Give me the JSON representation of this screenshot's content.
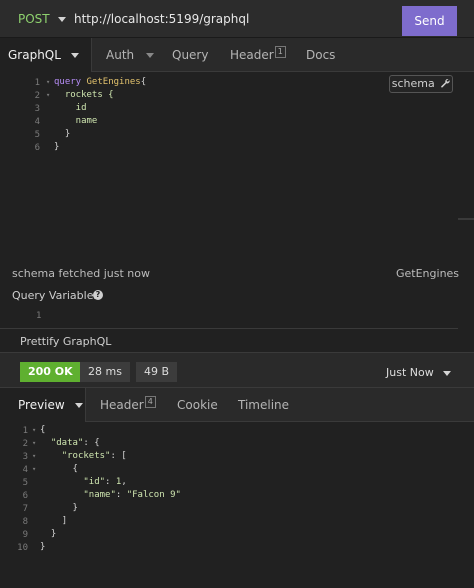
{
  "request": {
    "method": "POST",
    "url": "http://localhost:5199/graphql",
    "send_label": "Send"
  },
  "request_tabs": {
    "graphql": "GraphQL",
    "auth": "Auth",
    "query": "Query",
    "header": "Header",
    "header_count": "1",
    "docs": "Docs"
  },
  "editor": {
    "line_numbers": [
      "1",
      "2",
      "3",
      "4",
      "5",
      "6"
    ],
    "line1_kw": "query ",
    "line1_name": "GetEngines",
    "line1_brace": "{",
    "line2": "  rockets {",
    "line3": "    id",
    "line4": "    name",
    "line5": "  }",
    "line6": "}",
    "schema_label": "schema"
  },
  "status": {
    "left": "schema fetched just now",
    "right": "GetEngines"
  },
  "query_variables": {
    "label": "Query Variables",
    "line_number": "1"
  },
  "prettify_label": "Prettify GraphQL",
  "response": {
    "status": "200 OK",
    "time": "28 ms",
    "size": "49 B",
    "when": "Just Now"
  },
  "response_tabs": {
    "preview": "Preview",
    "header": "Header",
    "header_count": "4",
    "cookie": "Cookie",
    "timeline": "Timeline"
  },
  "response_body": {
    "line_numbers": [
      "1",
      "2",
      "3",
      "4",
      "5",
      "6",
      "7",
      "8",
      "9",
      "10"
    ],
    "l1": "{",
    "l2_key": "\"data\"",
    "l2_rest": ": {",
    "l3_key": "\"rockets\"",
    "l3_rest": ": [",
    "l4": "{",
    "l5_key": "\"id\"",
    "l5_colon": ": ",
    "l5_val": "1",
    "l5_comma": ",",
    "l6_key": "\"name\"",
    "l6_colon": ": ",
    "l6_val": "\"Falcon 9\"",
    "l7": "}",
    "l8": "]",
    "l9": "}",
    "l10": "}"
  },
  "colors": {
    "send": "#7e6ccd",
    "method": "#8ed16e",
    "status_ok": "#5fb030",
    "keyword": "#b58cf5",
    "operation_name": "#e2c26d"
  }
}
